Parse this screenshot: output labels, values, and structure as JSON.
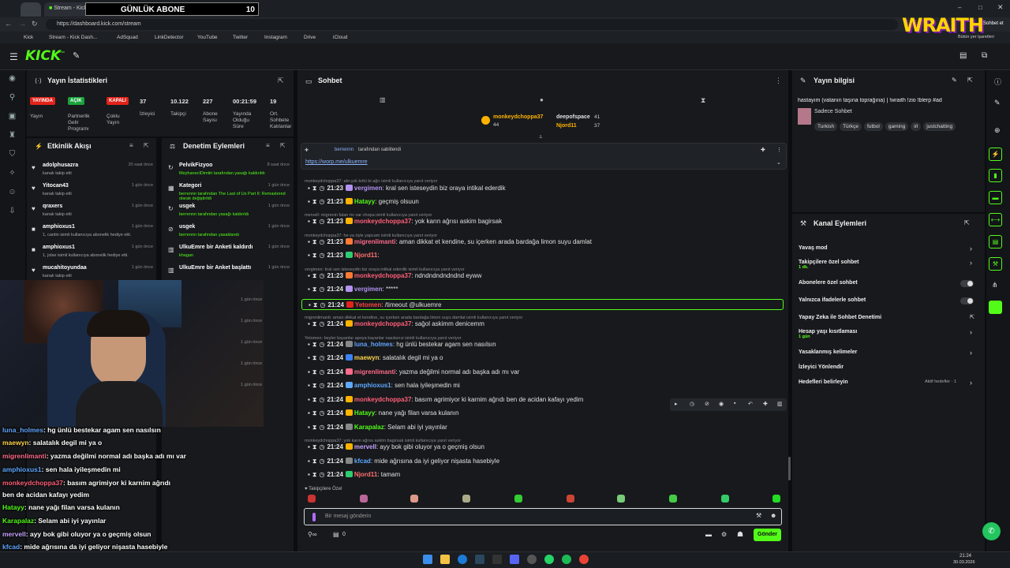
{
  "browser": {
    "tab1": "Stream - Kick Dash...",
    "tab_overlay_title": "GÜNLÜK ABONE",
    "tab_overlay_count": "10",
    "url": "https://dashboard.kick.com/stream",
    "bookmarks": [
      "Kick",
      "Stream - Kick Dash...",
      "AdSquad",
      "LinkDetector",
      "YouTube",
      "Twitter",
      "Instagram",
      "Drive",
      "iCloud"
    ],
    "profile_text": "Bütün yer işaretleri",
    "sohbet": "Sohbet et"
  },
  "brand": {
    "logo": "KICK",
    "badge": "beta",
    "wraith": "WRAITH",
    "accent": "#53fc18"
  },
  "stats": {
    "title": "Yayın İstatistikleri",
    "yayinda": "YAYINDA",
    "acik": "AÇIK",
    "kapali": "KAPALI",
    "n1": "37",
    "n2": "10.122",
    "n3": "227",
    "n4": "00:21:59",
    "n5": "19",
    "l_yayin": "Yayın",
    "l_partner": "Partnerlik Gelir Programı",
    "l_coklu": "Çoklu Yayın",
    "l_izleyici": "İzleyici",
    "l_takipci": "Takipçi",
    "l_abone": "Abone Sayısı",
    "l_sure": "Yayında Olduğu Süre",
    "l_ort": "Ort. Sohbete Katılanlar"
  },
  "activity": {
    "title": "Etkinlik Akışı",
    "items": [
      {
        "name": "adolphusazra",
        "desc": "kanalı takip etti",
        "time": "20 saat önce"
      },
      {
        "name": "Yitocan43",
        "desc": "kanalı takip etti",
        "time": "1 gün önce"
      },
      {
        "name": "qraxers",
        "desc": "kanalı takip etti",
        "time": "1 gün önce"
      },
      {
        "name": "amphioxus1",
        "desc": "1, cantin isimli kullanıcıya abonelik hediye etti.",
        "time": "1 gün önce"
      },
      {
        "name": "amphioxus1",
        "desc": "1, jolse isimli kullanıcıya abonelik hediye etti.",
        "time": "1 gün önce"
      },
      {
        "name": "mucahitoyundaa",
        "desc": "kanalı takip etti",
        "time": "1 gün önce"
      }
    ],
    "extra_times": [
      "1 gün önce",
      "1 gün önce",
      "1 gün önce",
      "1 gün önce",
      "1 gün önce"
    ]
  },
  "moderation": {
    "title": "Denetim Eylemleri",
    "items": [
      {
        "name": "PelvikFizyoo",
        "desc": "MeyhanecIDimitri tarafından yasağı kaldırıldı",
        "time": "8 saat önce"
      },
      {
        "name": "Kategori",
        "desc": "berrennn tarafından The Last of Us Part II: Remastered olarak değiştirildi",
        "time": "1 gün önce"
      },
      {
        "name": "usgek",
        "desc": "berrennn tarafından yasağı kaldırıldı",
        "time": "1 gün önce"
      },
      {
        "name": "usgek",
        "desc": "berrennn tarafından yasaklandı",
        "time": "1 gün önce"
      },
      {
        "name": "UlkuEmre bir Anketi kaldırdı",
        "desc": "khagan",
        "time": "1 gün önce"
      },
      {
        "name": "UlkuEmre bir Anket başlattı",
        "desc": "",
        "time": "1 gün önce"
      }
    ]
  },
  "chat": {
    "title": "Sohbet",
    "top_sup": {
      "name": "monkeydchoppa37",
      "count": "44",
      "r1": "deepofspace",
      "c1": "41",
      "r2": "Njord11",
      "c2": "37"
    },
    "pinned": {
      "by": "berrennn",
      "by_suffix": "tarafından sabitlendi",
      "link": "https://worp.me/ulkuemre"
    },
    "messages": [
      {
        "reply": "monkeydchoppa37: abi çok kötü bi ağrı isimli kullanıcıya yanıt veriyor",
        "time": "21:23",
        "user": "vergimen",
        "color": "#b392f0",
        "text": "kral sen isteseydin biz oraya intikal ederdik"
      },
      {
        "reply": "",
        "time": "21:23",
        "user": "Hatayy",
        "color": "#53fc18",
        "text": "geçmiş olsuun"
      },
      {
        "reply": "mervell: migrenin falan mı var chopa isimli kullanıcıya yanıt veriyor",
        "time": "21:23",
        "user": "monkeydchoppa37",
        "color": "#ff5f7a",
        "text": "yok karın ağrısı askim bagirsak"
      },
      {
        "reply": "monkeydchoppa37: he ya öyle yapcam isimli kullanıcıya yanıt veriyor",
        "time": "21:23",
        "user": "migrenlimanti",
        "color": "#ff6b8a",
        "text": "aman dikkat et kendine, su içerken arada bardağa limon suyu damlat"
      },
      {
        "reply": "",
        "time": "21:23",
        "user": "Njord11",
        "color": "#ff7070",
        "text": ""
      },
      {
        "reply": "vergimen: kral sen isteseydin biz oraya intikal ederdik isimli kullanıcıya yanıt veriyor",
        "time": "21:23",
        "user": "monkeydchoppa37",
        "color": "#ff5f7a",
        "text": "ndndndndndndnd eyww"
      },
      {
        "reply": "",
        "time": "21:24",
        "user": "vergimen",
        "color": "#b392f0",
        "text": "*****"
      },
      {
        "reply": "",
        "time": "21:24",
        "user": "Yetomen",
        "color": "#ff4040",
        "text": "/timeout @ulkuemre"
      },
      {
        "reply": "migrenlimanti: aman dikkat et kendine, su içerken arada bardağa limon suyu damlat isimli kullanıcıya yanıt veriyor",
        "time": "21:24",
        "user": "monkeydchoppa37",
        "color": "#ff5f7a",
        "text": "sağol askimm denicemm"
      },
      {
        "reply": "Yetomen: beyler bayanlar apoya kayanlar nasılsınız isimli kullanıcıya yanıt veriyor",
        "time": "21:24",
        "user": "luna_holmes",
        "color": "#63a4ff",
        "text": "hg ünlü bestekar agam sen nasılsın"
      },
      {
        "reply": "",
        "time": "21:24",
        "user": "maewyn",
        "color": "#ffd24d",
        "text": "salatalık degil mi ya o"
      },
      {
        "reply": "",
        "time": "21:24",
        "user": "migrenlimanti",
        "color": "#ff6b8a",
        "text": "yazma değilmi normal adı başka adı mı var"
      },
      {
        "reply": "",
        "time": "21:24",
        "user": "amphioxus1",
        "color": "#5fa8ff",
        "text": "sen hala iyileşmedin mi"
      },
      {
        "reply": "",
        "time": "21:24",
        "user": "monkeydchoppa37",
        "color": "#ff5f7a",
        "text": "basım agrimiyor ki karnim ağrıdı ben de acidan kafayı yedim"
      },
      {
        "reply": "",
        "time": "21:24",
        "user": "Hatayy",
        "color": "#53fc18",
        "text": "nane yağı filan varsa kulanın"
      },
      {
        "reply": "",
        "time": "21:24",
        "user": "Karapalaz",
        "color": "#53fc18",
        "text": "Selam abi iyi yayınlar"
      },
      {
        "reply": "monkeydchoppa37: yok karın ağrısı askim bagirsak isimli kullanıcıya yanıt veriyor",
        "time": "21:24",
        "user": "mervell",
        "color": "#c8a2ff",
        "text": "ayy bok gibi oluyor ya o geçmiş olsun"
      },
      {
        "reply": "",
        "time": "21:24",
        "user": "kfcad",
        "color": "#5fa8ff",
        "text": "mide ağrısına da iyi geliyor nişasta hasebiyle"
      },
      {
        "reply": "",
        "time": "21:24",
        "user": "Njord11",
        "color": "#ff7070",
        "text": "tamam"
      }
    ],
    "followers_only": "Takipçilere Özel",
    "placeholder": "Bir mesaj gönderin",
    "send": "Gönder",
    "count0": "0"
  },
  "overlay": [
    {
      "user": "luna_holmes",
      "text": ": hg ünlü bestekar agam sen nasılsın"
    },
    {
      "user": "maewyn",
      "text": ": salatalık degil mi ya o"
    },
    {
      "user": "migrenlimanti",
      "text": ": yazma değilmi normal adı başka adı mı var"
    },
    {
      "user": "amphioxus1",
      "text": ": sen hala iyileşmedin mi"
    },
    {
      "user": "monkeydchoppa37",
      "text": ": basım agrimiyor ki karnim ağrıdı"
    },
    {
      "user": "",
      "text": "ben de acidan kafayı yedim"
    },
    {
      "user": "Hatayy",
      "text": ": nane yağı filan varsa kulanın"
    },
    {
      "user": "Karapalaz",
      "text": ": Selam abi iyi yayınlar"
    },
    {
      "user": "mervell",
      "text": ": ayy bok gibi oluyor ya o geçmiş olsun"
    },
    {
      "user": "kfcad",
      "text": ": mide ağrısına da iyi geliyor nişasta hasebiyle"
    },
    {
      "user": "Njord11",
      "text": ": tamam"
    }
  ],
  "info": {
    "title": "Yayın bilgisi",
    "stream_title": "hastayım (vatanın taşına toprağına) | !wraith !zio !blerp #ad",
    "category": "Sadece Sohbet",
    "tags": [
      "Turkish",
      "Türkçe",
      "futbol",
      "gaming",
      "irl",
      "justchatting"
    ]
  },
  "channel": {
    "title": "Kanal Eylemleri",
    "items": [
      {
        "label": "Yavaş mod",
        "sub": ""
      },
      {
        "label": "Takipçilere özel sohbet",
        "sub": "1 dk."
      },
      {
        "label": "Abonelere özel sohbet",
        "sub": ""
      },
      {
        "label": "Yalnızca ifadelerle sohbet",
        "sub": ""
      },
      {
        "label": "Yapay Zeka ile Sohbet Denetimi",
        "sub": ""
      },
      {
        "label": "Hesap yaşı kısıtlaması",
        "sub": "1 gün"
      },
      {
        "label": "Yasaklanmış kelimeler",
        "sub": ""
      },
      {
        "label": "İzleyici Yönlendir",
        "sub": ""
      },
      {
        "label": "Hedefleri belirleyin",
        "sub": ""
      }
    ],
    "targets": "Aktif hedefler · 1"
  },
  "taskbar": {
    "time": "21:24",
    "date": "30.03.2026"
  }
}
